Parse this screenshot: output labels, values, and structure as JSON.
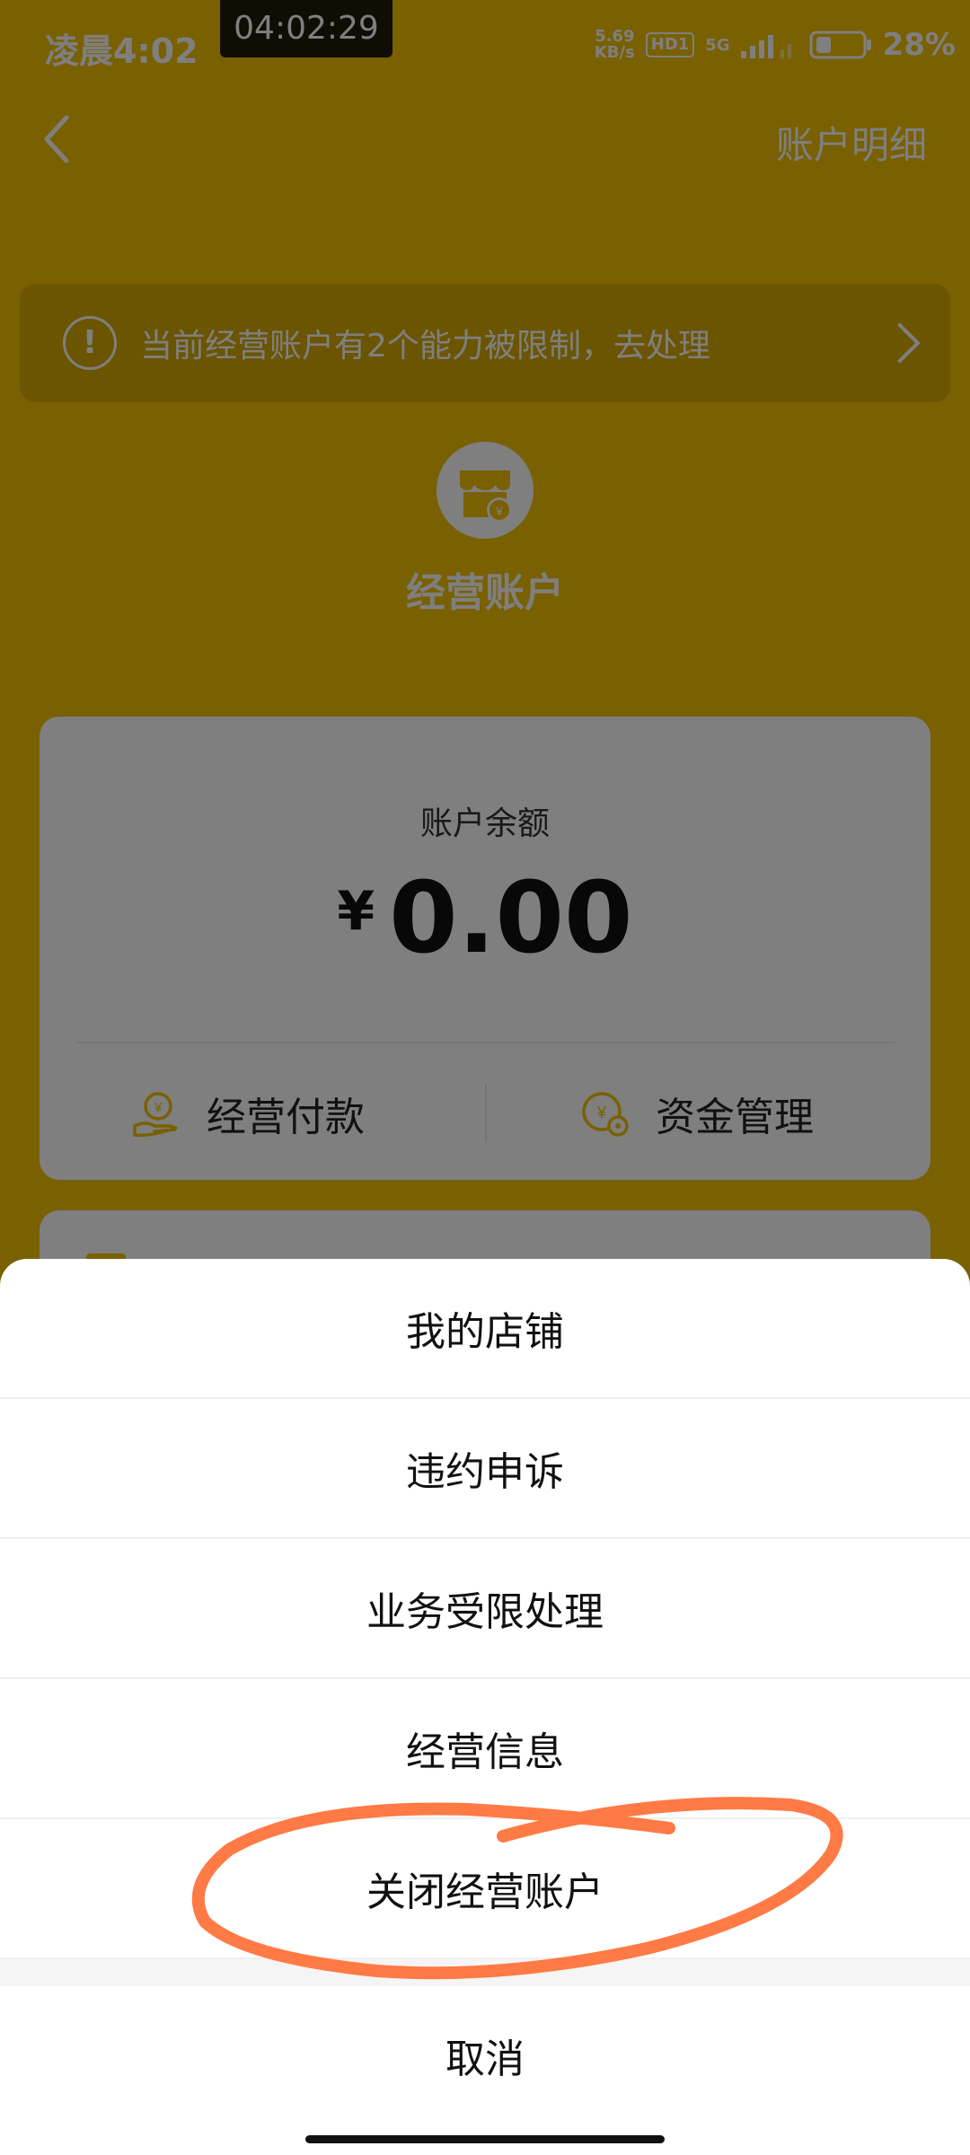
{
  "status_bar": {
    "time": "凌晨4:02",
    "recording_time": "04:02:29",
    "net_speed_value": "5.69",
    "net_speed_unit": "KB/s",
    "hd": "HD1",
    "network": "5G",
    "battery": "28%"
  },
  "header": {
    "account_detail": "账户明细"
  },
  "warning": {
    "text": "当前经营账户有2个能力被限制，去处理"
  },
  "account": {
    "title": "经营账户",
    "balance_label": "账户余额",
    "currency": "¥",
    "balance": "0.00",
    "actions": [
      {
        "label": "经营付款",
        "icon": "hand-yuan-icon"
      },
      {
        "label": "资金管理",
        "icon": "yuan-settings-icon"
      }
    ]
  },
  "action_sheet": {
    "items": [
      {
        "label": "我的店铺"
      },
      {
        "label": "违约申诉"
      },
      {
        "label": "业务受限处理"
      },
      {
        "label": "经营信息"
      },
      {
        "label": "关闭经营账户"
      }
    ],
    "cancel": "取消"
  },
  "colors": {
    "brand_yellow": "#F2C100",
    "annotation": "#FF7A45"
  }
}
